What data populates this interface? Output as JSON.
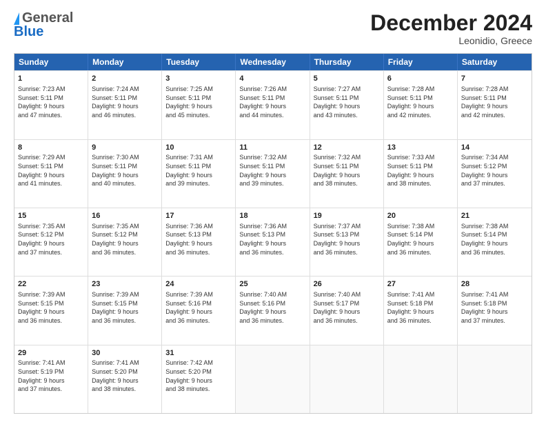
{
  "header": {
    "logo_general": "General",
    "logo_blue": "Blue",
    "month_title": "December 2024",
    "location": "Leonidio, Greece"
  },
  "weekdays": [
    "Sunday",
    "Monday",
    "Tuesday",
    "Wednesday",
    "Thursday",
    "Friday",
    "Saturday"
  ],
  "weeks": [
    [
      {
        "day": "1",
        "lines": [
          "Sunrise: 7:23 AM",
          "Sunset: 5:11 PM",
          "Daylight: 9 hours",
          "and 47 minutes."
        ]
      },
      {
        "day": "2",
        "lines": [
          "Sunrise: 7:24 AM",
          "Sunset: 5:11 PM",
          "Daylight: 9 hours",
          "and 46 minutes."
        ]
      },
      {
        "day": "3",
        "lines": [
          "Sunrise: 7:25 AM",
          "Sunset: 5:11 PM",
          "Daylight: 9 hours",
          "and 45 minutes."
        ]
      },
      {
        "day": "4",
        "lines": [
          "Sunrise: 7:26 AM",
          "Sunset: 5:11 PM",
          "Daylight: 9 hours",
          "and 44 minutes."
        ]
      },
      {
        "day": "5",
        "lines": [
          "Sunrise: 7:27 AM",
          "Sunset: 5:11 PM",
          "Daylight: 9 hours",
          "and 43 minutes."
        ]
      },
      {
        "day": "6",
        "lines": [
          "Sunrise: 7:28 AM",
          "Sunset: 5:11 PM",
          "Daylight: 9 hours",
          "and 42 minutes."
        ]
      },
      {
        "day": "7",
        "lines": [
          "Sunrise: 7:28 AM",
          "Sunset: 5:11 PM",
          "Daylight: 9 hours",
          "and 42 minutes."
        ]
      }
    ],
    [
      {
        "day": "8",
        "lines": [
          "Sunrise: 7:29 AM",
          "Sunset: 5:11 PM",
          "Daylight: 9 hours",
          "and 41 minutes."
        ]
      },
      {
        "day": "9",
        "lines": [
          "Sunrise: 7:30 AM",
          "Sunset: 5:11 PM",
          "Daylight: 9 hours",
          "and 40 minutes."
        ]
      },
      {
        "day": "10",
        "lines": [
          "Sunrise: 7:31 AM",
          "Sunset: 5:11 PM",
          "Daylight: 9 hours",
          "and 39 minutes."
        ]
      },
      {
        "day": "11",
        "lines": [
          "Sunrise: 7:32 AM",
          "Sunset: 5:11 PM",
          "Daylight: 9 hours",
          "and 39 minutes."
        ]
      },
      {
        "day": "12",
        "lines": [
          "Sunrise: 7:32 AM",
          "Sunset: 5:11 PM",
          "Daylight: 9 hours",
          "and 38 minutes."
        ]
      },
      {
        "day": "13",
        "lines": [
          "Sunrise: 7:33 AM",
          "Sunset: 5:11 PM",
          "Daylight: 9 hours",
          "and 38 minutes."
        ]
      },
      {
        "day": "14",
        "lines": [
          "Sunrise: 7:34 AM",
          "Sunset: 5:12 PM",
          "Daylight: 9 hours",
          "and 37 minutes."
        ]
      }
    ],
    [
      {
        "day": "15",
        "lines": [
          "Sunrise: 7:35 AM",
          "Sunset: 5:12 PM",
          "Daylight: 9 hours",
          "and 37 minutes."
        ]
      },
      {
        "day": "16",
        "lines": [
          "Sunrise: 7:35 AM",
          "Sunset: 5:12 PM",
          "Daylight: 9 hours",
          "and 36 minutes."
        ]
      },
      {
        "day": "17",
        "lines": [
          "Sunrise: 7:36 AM",
          "Sunset: 5:13 PM",
          "Daylight: 9 hours",
          "and 36 minutes."
        ]
      },
      {
        "day": "18",
        "lines": [
          "Sunrise: 7:36 AM",
          "Sunset: 5:13 PM",
          "Daylight: 9 hours",
          "and 36 minutes."
        ]
      },
      {
        "day": "19",
        "lines": [
          "Sunrise: 7:37 AM",
          "Sunset: 5:13 PM",
          "Daylight: 9 hours",
          "and 36 minutes."
        ]
      },
      {
        "day": "20",
        "lines": [
          "Sunrise: 7:38 AM",
          "Sunset: 5:14 PM",
          "Daylight: 9 hours",
          "and 36 minutes."
        ]
      },
      {
        "day": "21",
        "lines": [
          "Sunrise: 7:38 AM",
          "Sunset: 5:14 PM",
          "Daylight: 9 hours",
          "and 36 minutes."
        ]
      }
    ],
    [
      {
        "day": "22",
        "lines": [
          "Sunrise: 7:39 AM",
          "Sunset: 5:15 PM",
          "Daylight: 9 hours",
          "and 36 minutes."
        ]
      },
      {
        "day": "23",
        "lines": [
          "Sunrise: 7:39 AM",
          "Sunset: 5:15 PM",
          "Daylight: 9 hours",
          "and 36 minutes."
        ]
      },
      {
        "day": "24",
        "lines": [
          "Sunrise: 7:39 AM",
          "Sunset: 5:16 PM",
          "Daylight: 9 hours",
          "and 36 minutes."
        ]
      },
      {
        "day": "25",
        "lines": [
          "Sunrise: 7:40 AM",
          "Sunset: 5:16 PM",
          "Daylight: 9 hours",
          "and 36 minutes."
        ]
      },
      {
        "day": "26",
        "lines": [
          "Sunrise: 7:40 AM",
          "Sunset: 5:17 PM",
          "Daylight: 9 hours",
          "and 36 minutes."
        ]
      },
      {
        "day": "27",
        "lines": [
          "Sunrise: 7:41 AM",
          "Sunset: 5:18 PM",
          "Daylight: 9 hours",
          "and 36 minutes."
        ]
      },
      {
        "day": "28",
        "lines": [
          "Sunrise: 7:41 AM",
          "Sunset: 5:18 PM",
          "Daylight: 9 hours",
          "and 37 minutes."
        ]
      }
    ],
    [
      {
        "day": "29",
        "lines": [
          "Sunrise: 7:41 AM",
          "Sunset: 5:19 PM",
          "Daylight: 9 hours",
          "and 37 minutes."
        ]
      },
      {
        "day": "30",
        "lines": [
          "Sunrise: 7:41 AM",
          "Sunset: 5:20 PM",
          "Daylight: 9 hours",
          "and 38 minutes."
        ]
      },
      {
        "day": "31",
        "lines": [
          "Sunrise: 7:42 AM",
          "Sunset: 5:20 PM",
          "Daylight: 9 hours",
          "and 38 minutes."
        ]
      },
      null,
      null,
      null,
      null
    ]
  ]
}
